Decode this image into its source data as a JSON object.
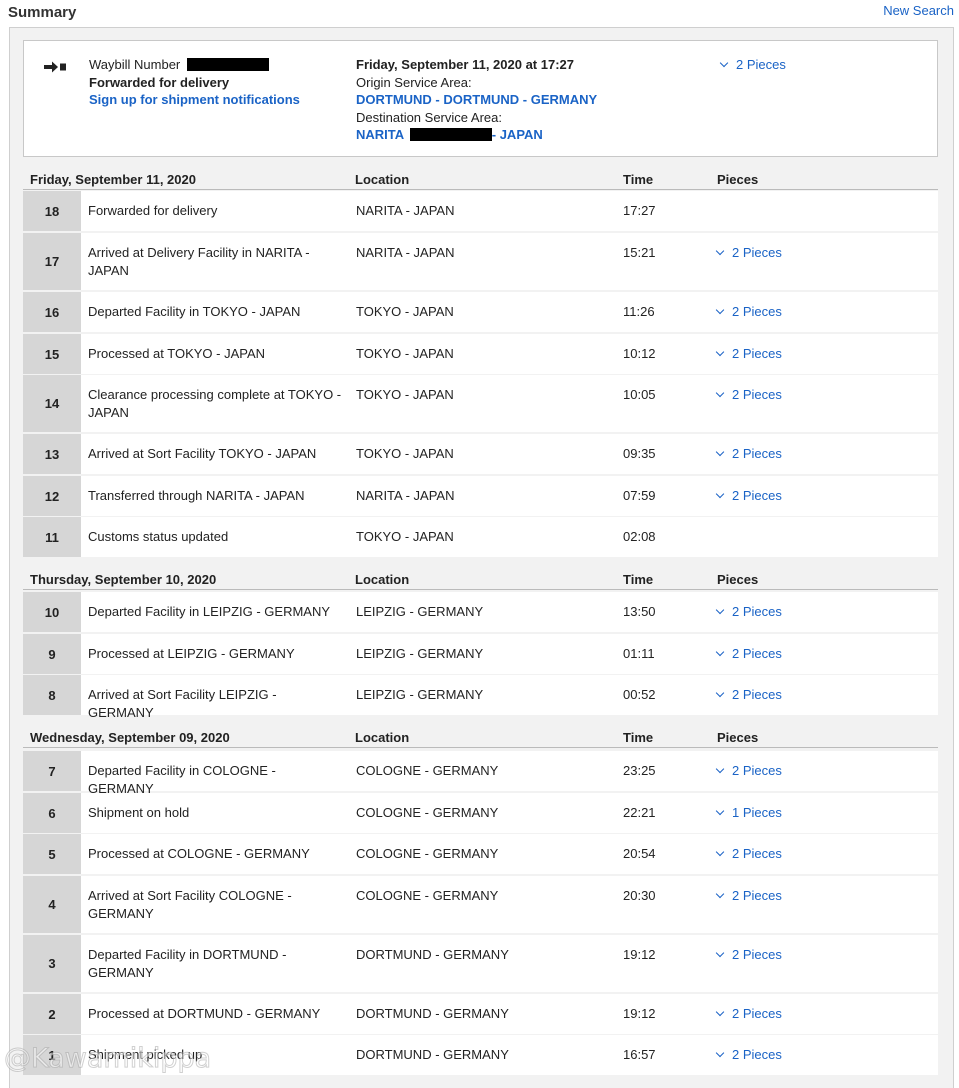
{
  "header": {
    "title": "Summary",
    "new_search": "New Search"
  },
  "summary": {
    "waybill_label": "Waybill Number",
    "status": "Forwarded for delivery",
    "notify_link": "Sign up for shipment notifications",
    "datetime": "Friday, September 11, 2020 at 17:27",
    "origin_label": "Origin Service Area:",
    "origin_value": "DORTMUND - DORTMUND - GERMANY",
    "dest_label": "Destination Service Area:",
    "dest_prefix": "NARITA",
    "dest_suffix": "- JAPAN",
    "pieces": "2 Pieces",
    "icon": "arrow-right-to-box-icon"
  },
  "columns": {
    "location": "Location",
    "time": "Time",
    "pieces": "Pieces"
  },
  "groups": [
    {
      "date": "Friday, September 11, 2020",
      "events": [
        {
          "num": "18",
          "activity": "Forwarded for delivery",
          "location": "NARITA - JAPAN",
          "time": "17:27",
          "pieces": ""
        },
        {
          "num": "17",
          "activity": "Arrived at Delivery Facility in NARITA - JAPAN",
          "location": "NARITA - JAPAN",
          "time": "15:21",
          "pieces": "2 Pieces"
        },
        {
          "num": "16",
          "activity": "Departed Facility in TOKYO - JAPAN",
          "location": "TOKYO - JAPAN",
          "time": "11:26",
          "pieces": "2 Pieces"
        },
        {
          "num": "15",
          "activity": "Processed at TOKYO - JAPAN",
          "location": "TOKYO - JAPAN",
          "time": "10:12",
          "pieces": "2 Pieces"
        },
        {
          "num": "14",
          "activity": "Clearance processing complete at TOKYO - JAPAN",
          "location": "TOKYO - JAPAN",
          "time": "10:05",
          "pieces": "2 Pieces"
        },
        {
          "num": "13",
          "activity": "Arrived at Sort Facility TOKYO - JAPAN",
          "location": "TOKYO - JAPAN",
          "time": "09:35",
          "pieces": "2 Pieces"
        },
        {
          "num": "12",
          "activity": "Transferred through NARITA - JAPAN",
          "location": "NARITA - JAPAN",
          "time": "07:59",
          "pieces": "2 Pieces"
        },
        {
          "num": "11",
          "activity": "Customs status updated",
          "location": "TOKYO - JAPAN",
          "time": "02:08",
          "pieces": ""
        }
      ]
    },
    {
      "date": "Thursday, September 10, 2020",
      "events": [
        {
          "num": "10",
          "activity": "Departed Facility in LEIPZIG - GERMANY",
          "location": "LEIPZIG - GERMANY",
          "time": "13:50",
          "pieces": "2 Pieces"
        },
        {
          "num": "9",
          "activity": "Processed at LEIPZIG - GERMANY",
          "location": "LEIPZIG - GERMANY",
          "time": "01:11",
          "pieces": "2 Pieces"
        },
        {
          "num": "8",
          "activity": "Arrived at Sort Facility LEIPZIG - GERMANY",
          "location": "LEIPZIG - GERMANY",
          "time": "00:52",
          "pieces": "2 Pieces"
        }
      ]
    },
    {
      "date": "Wednesday, September 09, 2020",
      "events": [
        {
          "num": "7",
          "activity": "Departed Facility in COLOGNE - GERMANY",
          "location": "COLOGNE - GERMANY",
          "time": "23:25",
          "pieces": "2 Pieces"
        },
        {
          "num": "6",
          "activity": "Shipment on hold",
          "location": "COLOGNE - GERMANY",
          "time": "22:21",
          "pieces": "1 Pieces"
        },
        {
          "num": "5",
          "activity": "Processed at COLOGNE - GERMANY",
          "location": "COLOGNE - GERMANY",
          "time": "20:54",
          "pieces": "2 Pieces"
        },
        {
          "num": "4",
          "activity": "Arrived at Sort Facility COLOGNE - GERMANY",
          "location": "COLOGNE - GERMANY",
          "time": "20:30",
          "pieces": "2 Pieces"
        },
        {
          "num": "3",
          "activity": "Departed Facility in DORTMUND - GERMANY",
          "location": "DORTMUND - GERMANY",
          "time": "19:12",
          "pieces": "2 Pieces"
        },
        {
          "num": "2",
          "activity": "Processed at DORTMUND - GERMANY",
          "location": "DORTMUND - GERMANY",
          "time": "19:12",
          "pieces": "2 Pieces"
        },
        {
          "num": "1",
          "activity": "Shipment picked up",
          "location": "DORTMUND - GERMANY",
          "time": "16:57",
          "pieces": "2 Pieces"
        }
      ]
    }
  ],
  "watermark": "@Kawamikippa",
  "colors": {
    "link": "#1a63c6",
    "number_cell": "#d6d6d6",
    "panel_bg": "#f2f2f2"
  }
}
